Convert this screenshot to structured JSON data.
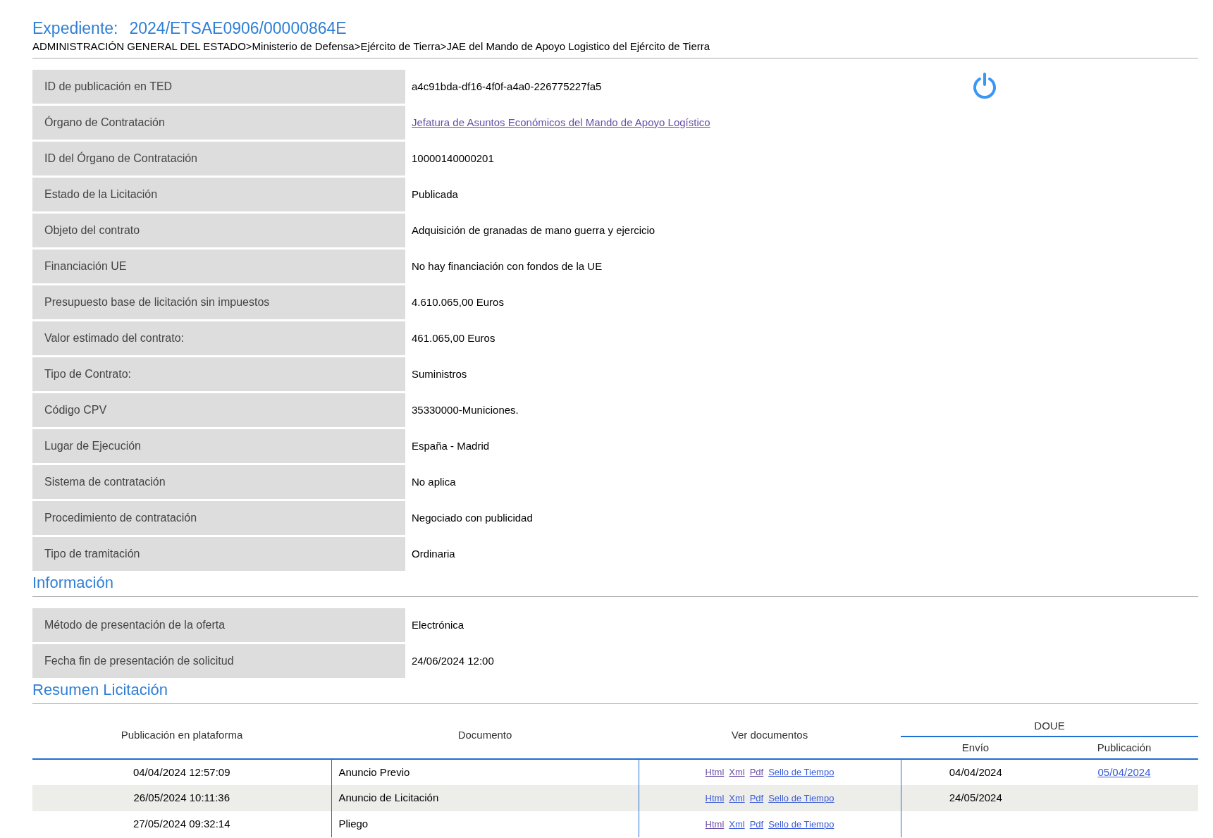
{
  "header": {
    "label": "Expediente:",
    "number": "2024/ETSAE0906/00000864E",
    "breadcrumb": "ADMINISTRACIÓN GENERAL DEL ESTADO>Ministerio de Defensa>Ejército de Tierra>JAE del Mando de Apoyo Logistico del Ejército de Tierra"
  },
  "details": [
    {
      "label": "ID de publicación en TED",
      "value": "a4c91bda-df16-4f0f-a4a0-226775227fa5",
      "kind": "text"
    },
    {
      "label": "Órgano de Contratación",
      "value": "Jefatura de Asuntos Económicos del Mando de Apoyo Logístico",
      "kind": "link",
      "visited": true
    },
    {
      "label": "ID del Órgano de Contratación",
      "value": "10000140000201",
      "kind": "text"
    },
    {
      "label": "Estado de la Licitación",
      "value": "Publicada",
      "kind": "text"
    },
    {
      "label": "Objeto del contrato",
      "value": "Adquisición de granadas de mano guerra y ejercicio",
      "kind": "text"
    },
    {
      "label": "Financiación UE",
      "value": "No hay financiación con fondos de la UE",
      "kind": "text"
    },
    {
      "label": "Presupuesto base de licitación sin impuestos",
      "value": "4.610.065,00 Euros",
      "kind": "text"
    },
    {
      "label": "Valor estimado del contrato:",
      "value": "461.065,00 Euros",
      "kind": "text"
    },
    {
      "label": "Tipo de Contrato:",
      "value": "Suministros",
      "kind": "text"
    },
    {
      "label": "Código CPV",
      "value": "35330000-Municiones.",
      "kind": "text"
    },
    {
      "label": "Lugar de Ejecución",
      "value": "España - Madrid",
      "kind": "text"
    },
    {
      "label": "Sistema de contratación",
      "value": "No aplica",
      "kind": "text"
    },
    {
      "label": "Procedimiento de contratación",
      "value": "Negociado con publicidad",
      "kind": "text"
    },
    {
      "label": "Tipo de tramitación",
      "value": "Ordinaria",
      "kind": "text"
    }
  ],
  "info": {
    "title": "Información",
    "details": [
      {
        "label": "Método de presentación de la oferta",
        "value": "Electrónica"
      },
      {
        "label": "Fecha fin de presentación de solicitud",
        "value": "24/06/2024 12:00"
      }
    ]
  },
  "summary": {
    "title": "Resumen Licitación",
    "columns": {
      "publication": "Publicación en plataforma",
      "document": "Documento",
      "view": "Ver documentos",
      "group": "DOUE",
      "sent": "Envío",
      "published": "Publicación"
    },
    "rows": [
      {
        "publication": "04/04/2024 12:57:09",
        "document": "Anuncio Previo",
        "links": [
          {
            "label": "Html",
            "visited": true
          },
          {
            "label": "Xml",
            "visited": true
          },
          {
            "label": "Pdf",
            "visited": true
          },
          {
            "label": "Sello de Tiempo",
            "visited": false
          }
        ],
        "sent": "04/04/2024",
        "published": "05/04/2024"
      },
      {
        "publication": "26/05/2024 10:11:36",
        "document": "Anuncio de Licitación",
        "links": [
          {
            "label": "Html",
            "visited": false
          },
          {
            "label": "Xml",
            "visited": false
          },
          {
            "label": "Pdf",
            "visited": false
          },
          {
            "label": "Sello de Tiempo",
            "visited": false
          }
        ],
        "sent": "24/05/2024"
      },
      {
        "publication": "27/05/2024 09:32:14",
        "document": "Pliego",
        "links": [
          {
            "label": "Html",
            "visited": true
          },
          {
            "label": "Xml",
            "visited": false
          },
          {
            "label": "Pdf",
            "visited": false
          },
          {
            "label": "Sello de Tiempo",
            "visited": false
          }
        ]
      }
    ]
  }
}
